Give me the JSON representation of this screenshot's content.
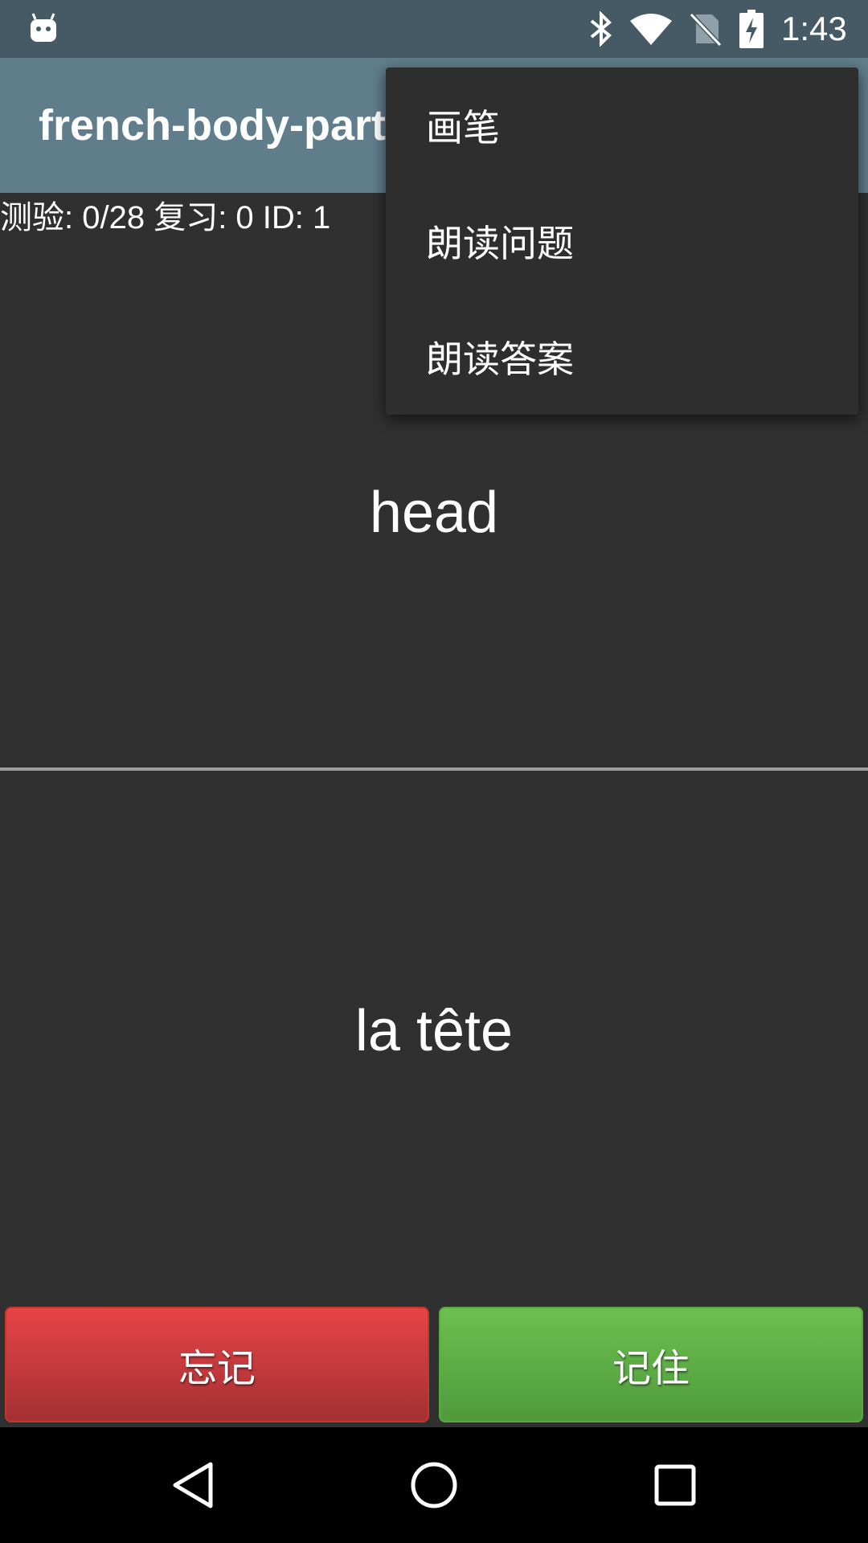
{
  "status_bar": {
    "time": "1:43",
    "icons": [
      "android-debug-icon",
      "bluetooth-icon",
      "wifi-icon",
      "no-sim-icon",
      "battery-charging-icon"
    ]
  },
  "app_bar": {
    "title": "french-body-parts"
  },
  "stats": {
    "text": "测验: 0/28 复习: 0 ID: 1"
  },
  "card": {
    "question": "head",
    "answer": "la tête"
  },
  "buttons": {
    "forget_label": "忘记",
    "remember_label": "记住"
  },
  "overflow_menu": {
    "items": [
      {
        "label": "画笔"
      },
      {
        "label": "朗读问题"
      },
      {
        "label": "朗读答案"
      }
    ]
  },
  "nav_bar": {
    "icons": [
      "back-icon",
      "home-icon",
      "recents-icon"
    ]
  },
  "colors": {
    "status_bar": "#455a64",
    "app_bar": "#607d8b",
    "background": "#303030",
    "forget_button": "#e04044",
    "remember_button": "#62b24a",
    "menu_background": "#2e2e2e"
  }
}
